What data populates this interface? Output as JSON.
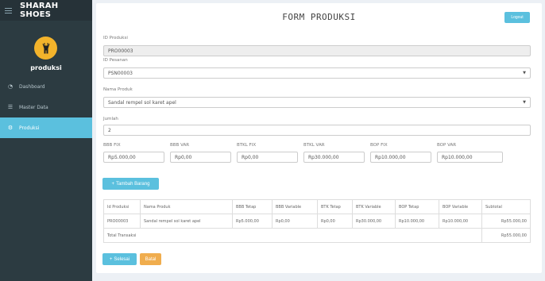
{
  "sidebar": {
    "brand": "SHARAH SHOES",
    "user": "produksi",
    "items": [
      {
        "label": "Dashboard",
        "icon": "dashboard-icon"
      },
      {
        "label": "Master Data",
        "icon": "list-icon"
      },
      {
        "label": "Produksi",
        "icon": "gears-icon"
      }
    ]
  },
  "header": {
    "title": "FORM PRODUKSI",
    "logout": "Logout"
  },
  "form": {
    "id_produksi": {
      "label": "ID Produksi",
      "value": "PRO00003"
    },
    "id_pesanan": {
      "label": "ID Pesanan",
      "value": "PSN00003"
    },
    "nama_produk": {
      "label": "Nama Produk",
      "value": "Sandal rempel sol karet apel"
    },
    "jumlah": {
      "label": "Jumlah",
      "value": "2"
    },
    "costs": [
      {
        "label": "BBB FIX",
        "value": "Rp5.000,00"
      },
      {
        "label": "BBB VAR",
        "value": "Rp0,00"
      },
      {
        "label": "BTKL FIX",
        "value": "Rp0,00"
      },
      {
        "label": "BTKL VAR",
        "value": "Rp30.000,00"
      },
      {
        "label": "BOP FIX",
        "value": "Rp10.000,00"
      },
      {
        "label": "BOP VAR",
        "value": "Rp10.000,00"
      }
    ]
  },
  "buttons": {
    "add": "Tambah Barang",
    "finish": "Selesai",
    "cancel": "Batal"
  },
  "table": {
    "headers": [
      "Id Produksi",
      "Nama Produk",
      "BBB Tetap",
      "BBB Variable",
      "BTK Tetap",
      "BTK Variable",
      "BOP Tetap",
      "BOP Variable",
      "Subtotal"
    ],
    "row": [
      "PRO00003",
      "Sandal rempel sol karet apel",
      "Rp5.000,00",
      "Rp0,00",
      "Rp0,00",
      "Rp30.000,00",
      "Rp10.000,00",
      "Rp10.000,00",
      "Rp55.000,00"
    ],
    "total_label": "Total Transaksi",
    "total_value": "Rp55.000,00"
  },
  "colors": {
    "accent": "#5bc0de",
    "warning": "#f0ad4e",
    "sidebar": "#2c3b41",
    "avatar": "#f3b32b"
  }
}
